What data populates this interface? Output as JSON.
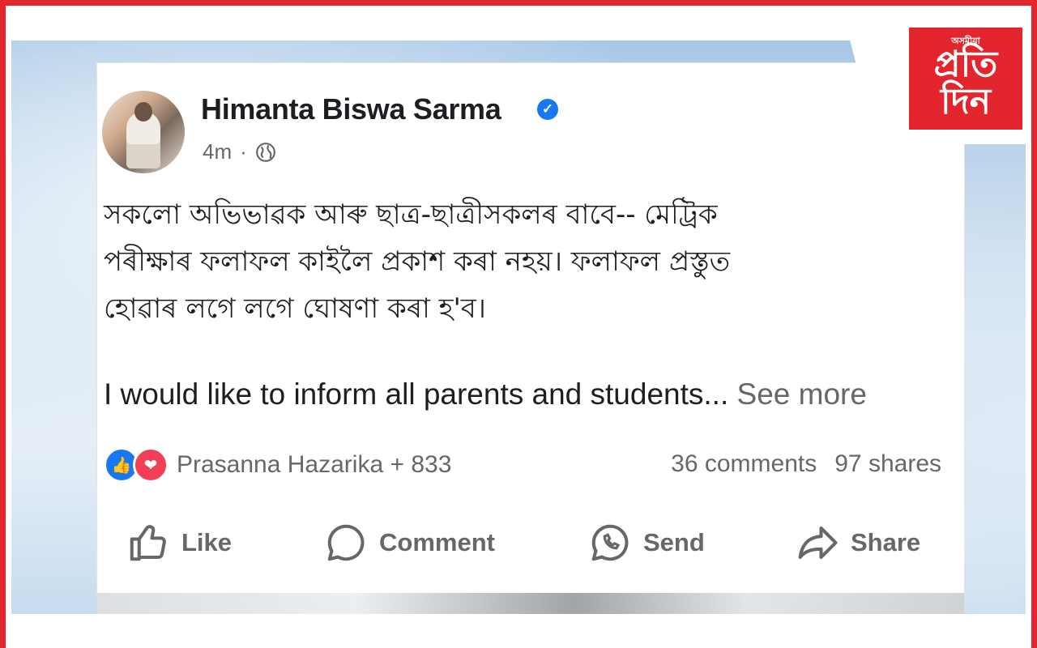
{
  "logo": {
    "line1": "অসমীয়া",
    "line2": "প্রতি",
    "line3": "দিন"
  },
  "post": {
    "author": "Himanta Biswa Sarma",
    "time": "4m",
    "dot": "·",
    "body_bengali": [
      "সকলো অভিভাৱক আৰু ছাত্ৰ-ছাত্ৰীসকলৰ বাবে-- মেট্ৰিক",
      "পৰীক্ষাৰ ফলাফল কাইলৈ প্ৰকাশ কৰা নহয়। ফলাফল প্ৰস্তুত",
      "হোৱাৰ লগে লগে ঘোষণা কৰা হ'ব।"
    ],
    "body_english": "I would like to inform all parents and students...",
    "see_more": "See more",
    "reactions_text": "Prasanna Hazarika + 833",
    "comments": "36 comments",
    "shares": "97 shares"
  },
  "actions": {
    "like": "Like",
    "comment": "Comment",
    "send": "Send",
    "share": "Share"
  },
  "colors": {
    "frame": "#e3262d",
    "facebook_blue": "#1877f2",
    "love_red": "#f33e58",
    "secondary_text": "#65676b"
  }
}
